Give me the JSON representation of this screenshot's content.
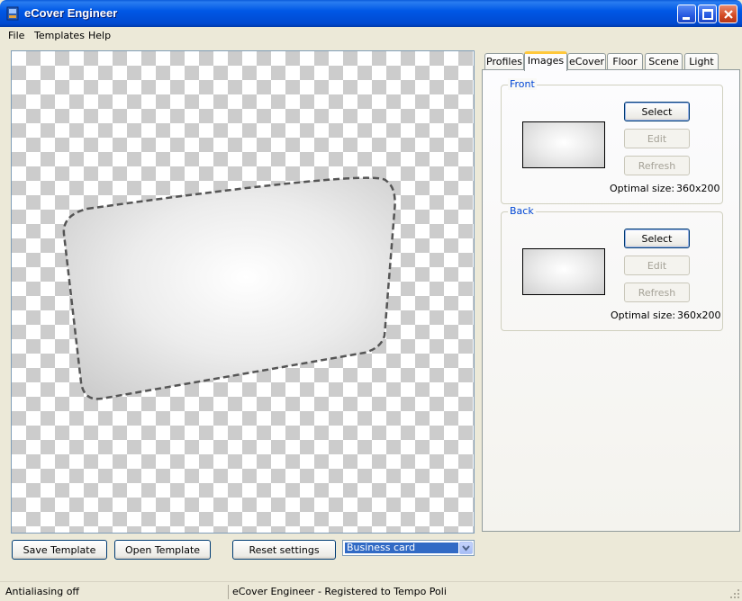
{
  "window": {
    "title": "eCover Engineer"
  },
  "menu": {
    "items": [
      "File",
      "Templates",
      "Help"
    ]
  },
  "tabs": [
    "Profiles",
    "Images",
    "eCover",
    "Floor",
    "Scene",
    "Light"
  ],
  "front": {
    "title": "Front",
    "select_label": "Select",
    "edit_label": "Edit",
    "refresh_label": "Refresh",
    "optimal_label": "Optimal size:",
    "optimal_value": "360x200"
  },
  "back": {
    "title": "Back",
    "select_label": "Select",
    "edit_label": "Edit",
    "refresh_label": "Refresh",
    "optimal_label": "Optimal size:",
    "optimal_value": "360x200"
  },
  "bottom": {
    "save_label": "Save Template",
    "open_label": "Open Template",
    "reset_label": "Reset settings",
    "template_selected": "Business card"
  },
  "status": {
    "left": "Antialiasing off",
    "right": "eCover Engineer - Registered to Tempo Poli"
  },
  "colors": {
    "titlebar": "#0058e6",
    "selection": "#316ac5",
    "group_title": "#0046d5",
    "active_tab_accent": "#ffc83c"
  }
}
